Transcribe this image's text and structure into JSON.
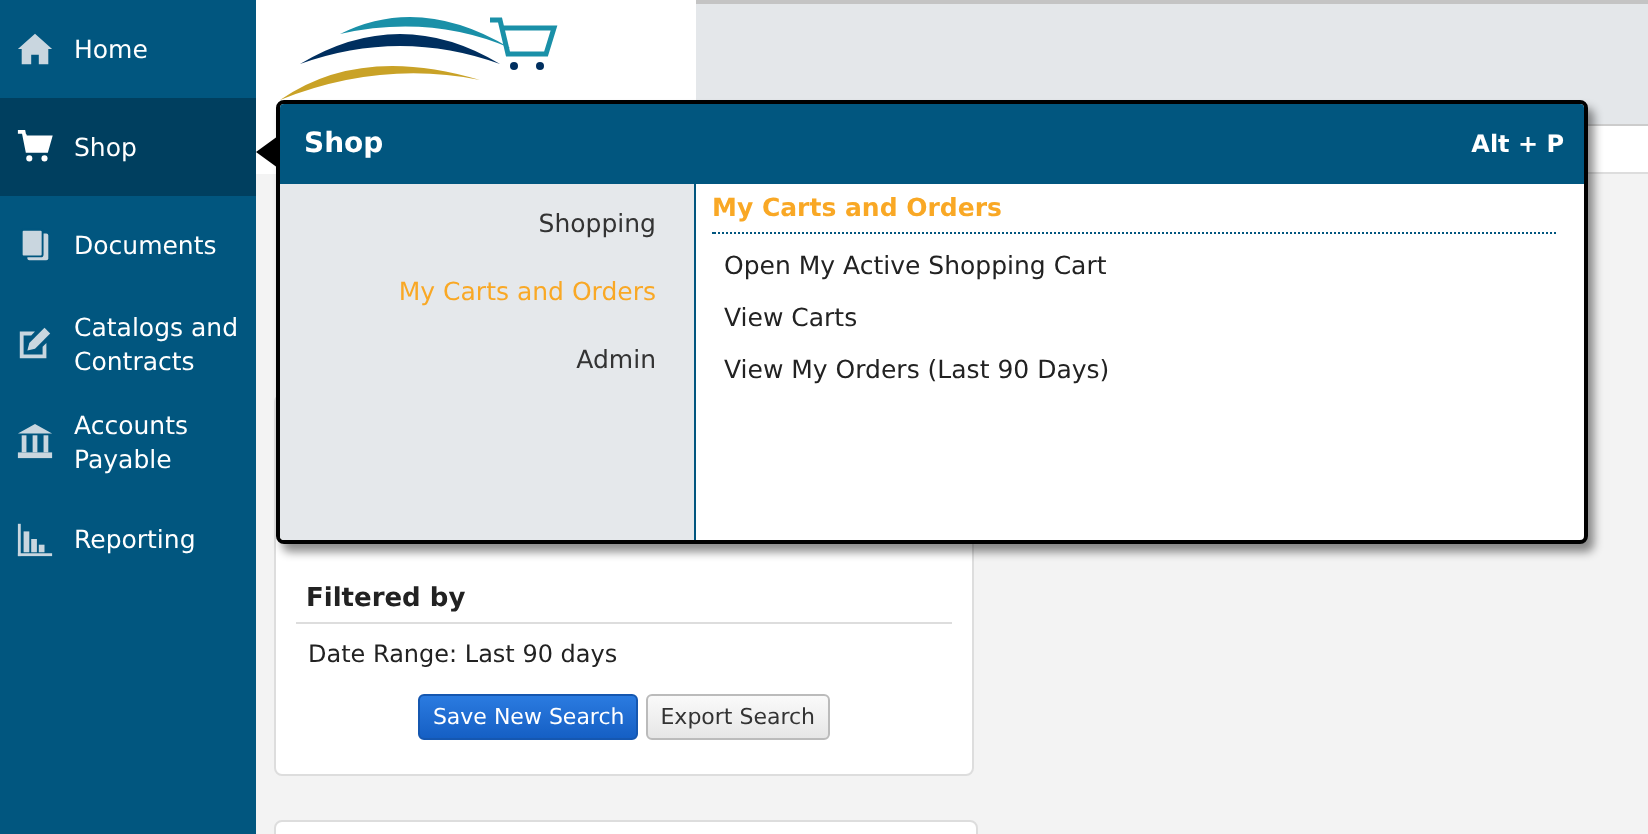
{
  "sidebar": {
    "items": [
      {
        "label": "Home",
        "selected": false
      },
      {
        "label": "Shop",
        "selected": true
      },
      {
        "label": "Documents",
        "selected": false
      },
      {
        "label": "Catalogs and Contracts",
        "selected": false
      },
      {
        "label": "Accounts Payable",
        "selected": false
      },
      {
        "label": "Reporting",
        "selected": false
      }
    ]
  },
  "flyout": {
    "title": "Shop",
    "shortcut": "Alt + P",
    "categories": [
      {
        "label": "Shopping",
        "selected": false
      },
      {
        "label": "My Carts and Orders",
        "selected": true
      },
      {
        "label": "Admin",
        "selected": false
      }
    ],
    "section_title": "My Carts and Orders",
    "links": [
      "Open My Active Shopping Cart",
      "View Carts",
      "View My Orders (Last 90 Days)"
    ]
  },
  "filter_card": {
    "title": "Filtered by",
    "filters": [
      "Date Range: Last 90 days"
    ],
    "buttons": [
      {
        "label": "Save New Search",
        "kind": "primary"
      },
      {
        "label": "Export Search",
        "kind": "secondary"
      }
    ]
  }
}
